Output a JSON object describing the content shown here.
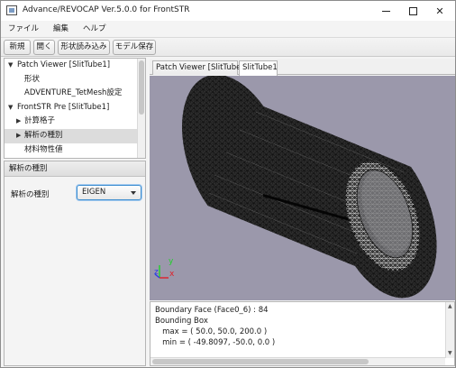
{
  "window": {
    "title": "Advance/REVOCAP Ver.5.0.0 for FrontSTR",
    "controls": [
      "minimize",
      "maximize",
      "close"
    ],
    "close_glyph": "✕"
  },
  "menu": [
    "ファイル",
    "編集",
    "ヘルプ"
  ],
  "toolbar": {
    "buttons": [
      "新規",
      "開く",
      "形状読み込み",
      "モデル保存"
    ]
  },
  "tree": {
    "items": [
      {
        "label": "Patch Viewer [SlitTube1]",
        "arrow": "▼",
        "level": 0
      },
      {
        "label": "形状",
        "arrow": "",
        "level": 1
      },
      {
        "label": "ADVENTURE_TetMesh設定",
        "arrow": "",
        "level": 1
      },
      {
        "label": "FrontSTR Pre [SlitTube1]",
        "arrow": "▼",
        "level": 0
      },
      {
        "label": "計算格子",
        "arrow": "▶",
        "level": 1
      },
      {
        "label": "解析の種別",
        "arrow": "▶",
        "level": 1,
        "selected": true
      },
      {
        "label": "材料物性値",
        "arrow": "",
        "level": 1
      }
    ]
  },
  "properties": {
    "header": "解析の種別",
    "field_label": "解析の種別",
    "selected_value": "EIGEN"
  },
  "tabs": [
    "Patch Viewer [SlitTube1]",
    "SlitTube1"
  ],
  "viewport": {
    "background_color": "#9b98ab",
    "mesh_color": "#1a1a1a",
    "axis_labels": {
      "x": "x",
      "y": "y",
      "z": "z"
    },
    "axis_colors": {
      "x": "#e0202a",
      "y": "#1fd12a",
      "z": "#2a3ee6"
    }
  },
  "console": {
    "lines": [
      "Boundary Face (Face0_6) : 84",
      "Bounding Box",
      "   max = ( 50.0, 50.0, 200.0 )",
      "   min = ( -49.8097, -50.0, 0.0 )"
    ]
  }
}
